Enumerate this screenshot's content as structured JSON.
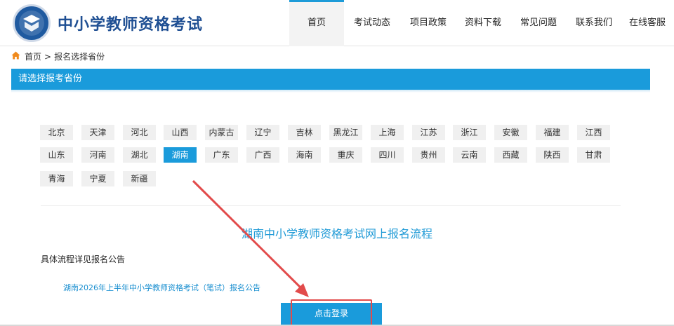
{
  "header": {
    "site_title": "中小学教师资格考试",
    "nav": [
      {
        "label": "首页",
        "active": true
      },
      {
        "label": "考试动态",
        "active": false
      },
      {
        "label": "项目政策",
        "active": false
      },
      {
        "label": "资料下载",
        "active": false
      },
      {
        "label": "常见问题",
        "active": false
      },
      {
        "label": "联系我们",
        "active": false
      },
      {
        "label": "在线客服",
        "active": false
      }
    ]
  },
  "breadcrumb": {
    "home": "首页",
    "separator": ">",
    "current": "报名选择省份"
  },
  "section_bar": {
    "title": "请选择报考省份"
  },
  "provinces": [
    "北京",
    "天津",
    "河北",
    "山西",
    "内蒙古",
    "辽宁",
    "吉林",
    "黑龙江",
    "上海",
    "江苏",
    "浙江",
    "安徽",
    "福建",
    "江西",
    "山东",
    "河南",
    "湖北",
    "湖南",
    "广东",
    "广西",
    "海南",
    "重庆",
    "四川",
    "贵州",
    "云南",
    "西藏",
    "陕西",
    "甘肃",
    "青海",
    "宁夏",
    "新疆"
  ],
  "selected_province": "湖南",
  "flow": {
    "title": "湖南中小学教师资格考试网上报名流程",
    "detail_text": "具体流程详见报名公告",
    "notice_link": "湖南2026年上半年中小学教师资格考试（笔试）报名公告",
    "login_button": "点击登录"
  },
  "colors": {
    "accent": "#1a9bdb",
    "brand_blue": "#1f4f93",
    "annotation_red": "#e24b4b"
  }
}
